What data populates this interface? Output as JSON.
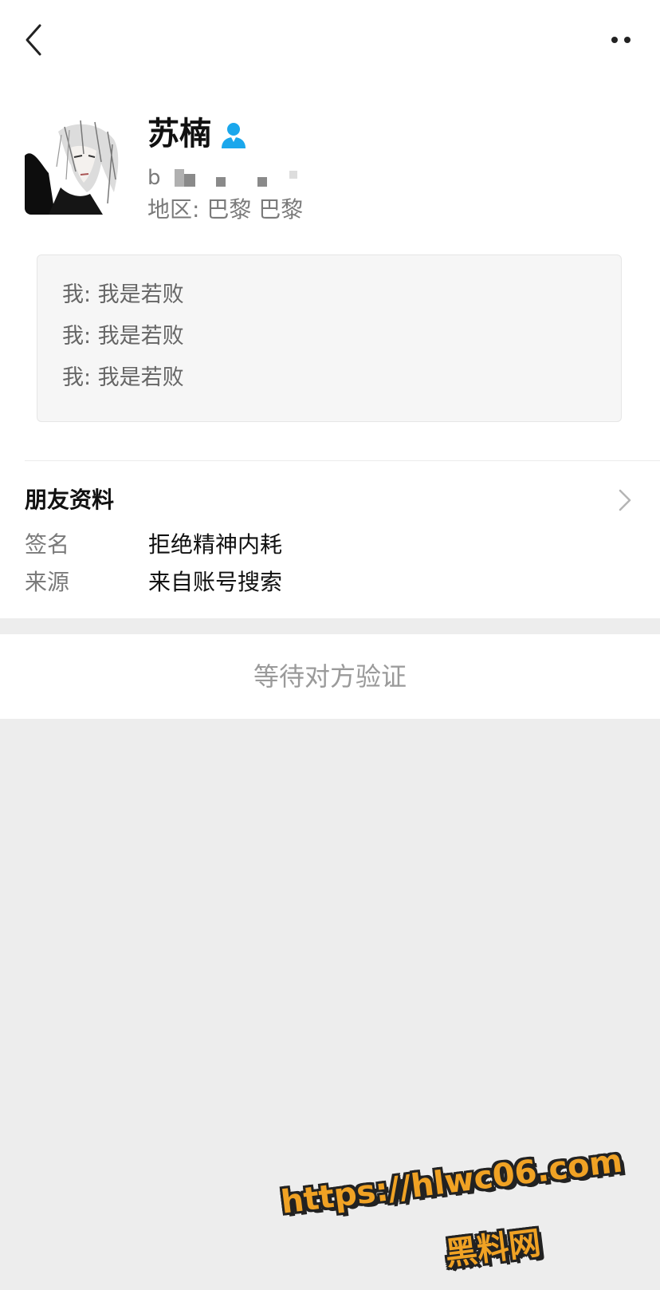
{
  "header": {
    "back_icon": "chevron-left-icon",
    "more_icon": "more-dots-icon"
  },
  "profile": {
    "name": "苏楠",
    "gender_icon": "male-user-icon",
    "gender_color": "#1aa7ec",
    "account_prefix": "b",
    "region": "地区: 巴黎 巴黎"
  },
  "chat_preview": {
    "messages": [
      "我: 我是若败",
      "我: 我是若败",
      "我: 我是若败"
    ]
  },
  "friend_info": {
    "title": "朋友资料",
    "fields": [
      {
        "label": "签名",
        "value": "拒绝精神内耗"
      },
      {
        "label": "来源",
        "value": "来自账号搜索"
      }
    ]
  },
  "action": {
    "label": "等待对方验证"
  },
  "watermark": {
    "line1": "https://hlwc06.com",
    "line2": "黑料网",
    "color": "#f0a224"
  }
}
